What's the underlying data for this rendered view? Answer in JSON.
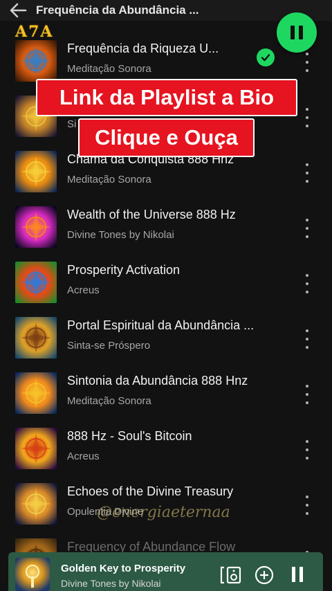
{
  "header": {
    "title": "Frequência da Abundância ...",
    "logo_text": "A7A"
  },
  "tracks": [
    {
      "title": "Frequência da Riqueza U...",
      "artist": "Meditação Sonora",
      "downloaded": true,
      "art": [
        "#3b1a06",
        "#d85a10",
        "#2d7fd0"
      ]
    },
    {
      "title": "",
      "artist": "Si",
      "downloaded": false,
      "art": [
        "#1a1530",
        "#c2822a",
        "#f2c53a"
      ]
    },
    {
      "title": "Chama da Conquista 888 Hnz",
      "artist": "Meditação Sonora",
      "downloaded": false,
      "art": [
        "#0f2a55",
        "#e88a12",
        "#f6d23a"
      ]
    },
    {
      "title": "Wealth of the Universe 888 Hz",
      "artist": "Divine Tones by Nikolai",
      "downloaded": false,
      "art": [
        "#0a0620",
        "#d52ac0",
        "#ff8a1a"
      ]
    },
    {
      "title": "Prosperity Activation",
      "artist": "Acreus",
      "downloaded": false,
      "art": [
        "#1d8a2a",
        "#e84a14",
        "#2a7ae0"
      ]
    },
    {
      "title": "Portal Espiritual da Abundância ...",
      "artist": "Sinta-se Próspero",
      "downloaded": false,
      "art": [
        "#1a4a6a",
        "#e0a228",
        "#7a3a12"
      ]
    },
    {
      "title": "Sintonia da Abundância 888 Hnz",
      "artist": "Meditação Sonora",
      "downloaded": false,
      "art": [
        "#0a2a60",
        "#f08a1e",
        "#f6c42a"
      ]
    },
    {
      "title": "888 Hz - Soul's Bitcoin",
      "artist": "Acreus",
      "downloaded": false,
      "art": [
        "#2a0a40",
        "#f2a81c",
        "#d43a14"
      ]
    },
    {
      "title": "Echoes of the Divine Treasury",
      "artist": "Opulentia Divine",
      "downloaded": false,
      "art": [
        "#10163a",
        "#d8892a",
        "#f5d046"
      ]
    },
    {
      "title": "Frequency of Abundance Flow",
      "artist": "",
      "downloaded": false,
      "art": [
        "#3a2810",
        "#a86a1a",
        "#4a2a10"
      ]
    }
  ],
  "overlay": {
    "banner_line1": "Link da Playlist a Bio",
    "banner_line2": "Clique e Ouça",
    "watermark": "@energiaeternaa"
  },
  "now_playing": {
    "title": "Golden Key to Prosperity",
    "artist": "Divine Tones by Nikolai",
    "bar_color": "#2c5a45"
  },
  "colors": {
    "accent": "#1ed760",
    "banner_red": "#e51420",
    "logo_gold": "#f2c027"
  },
  "icons": {
    "back": "arrow-left-icon",
    "fab": "pause-icon",
    "row_menu": "more-vertical-icon",
    "downloaded": "check-circle-icon",
    "device": "connect-device-icon",
    "add": "add-circle-icon",
    "player_pause": "pause-icon"
  }
}
